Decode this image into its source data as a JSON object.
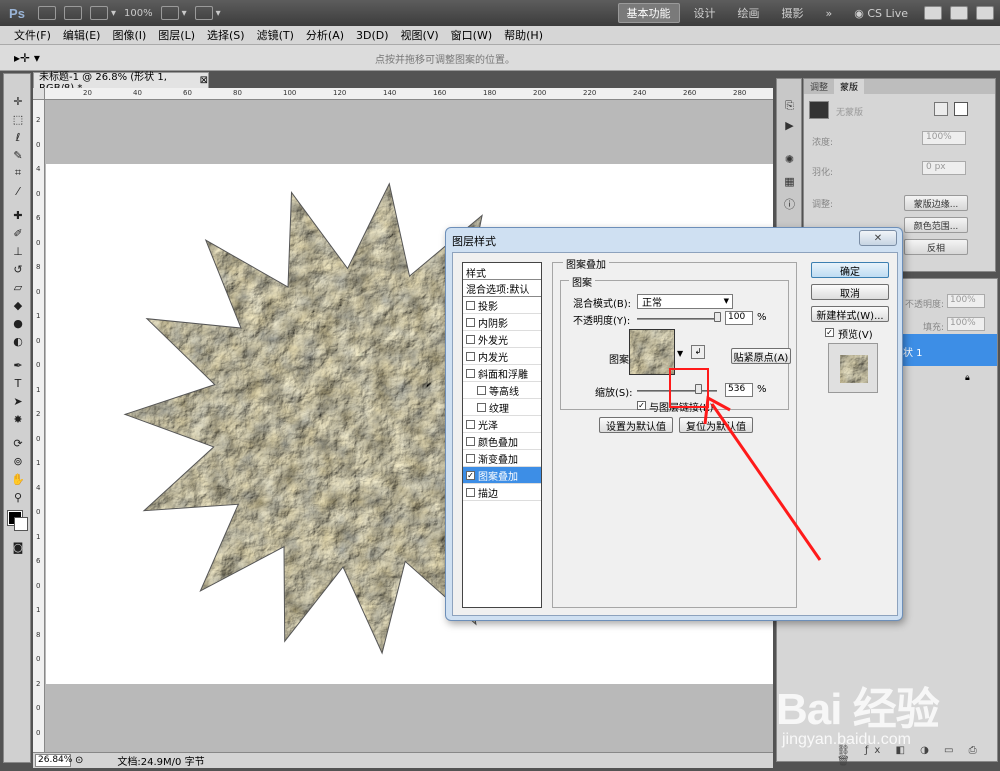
{
  "app": {
    "logo": "Ps",
    "zoom_preset": "100%",
    "workspaces": [
      "基本功能",
      "设计",
      "绘画",
      "摄影"
    ],
    "more": "»",
    "cs_live": "CS Live"
  },
  "menu": [
    "文件(F)",
    "编辑(E)",
    "图像(I)",
    "图层(L)",
    "选择(S)",
    "滤镜(T)",
    "分析(A)",
    "3D(D)",
    "视图(V)",
    "窗口(W)",
    "帮助(H)"
  ],
  "options_hint": "点按并拖移可调整图案的位置。",
  "document": {
    "tab_title": "未标题-1 @ 26.8% (形状 1, RGB/8) *",
    "ruler_h": [
      "20",
      "40",
      "60",
      "80",
      "100",
      "120",
      "140",
      "160",
      "180",
      "200",
      "220",
      "240",
      "260",
      "280"
    ],
    "ruler_v": [
      "2",
      "0",
      "4",
      "0",
      "6",
      "0",
      "8",
      "0",
      "1",
      "0",
      "0",
      "1",
      "2",
      "0",
      "1",
      "4",
      "0",
      "1",
      "6",
      "0",
      "1",
      "8",
      "0",
      "2",
      "0",
      "0"
    ],
    "zoom": "26.84%",
    "doc_info": "文档:24.9M/0 字节"
  },
  "masks_panel": {
    "tabs": [
      "调整",
      "蒙版"
    ],
    "no_mask": "无蒙版",
    "density_label": "浓度:",
    "density_value": "100%",
    "feather_label": "羽化:",
    "feather_value": "0 px",
    "refine_label": "调整:",
    "btn_mask_edge": "蒙版边缘...",
    "btn_color_range": "颜色范围...",
    "btn_invert": "反相"
  },
  "layers_panel": {
    "opacity_label": "不透明度:",
    "opacity_value": "100%",
    "fill_label": "填充:",
    "fill_value": "100%",
    "selected_layer": "状 1"
  },
  "dialog": {
    "title": "图层样式",
    "close": "✕",
    "styles_header": "样式",
    "blend_options": "混合选项:默认",
    "styles": [
      {
        "label": "投影",
        "checked": false,
        "indent": false
      },
      {
        "label": "内阴影",
        "checked": false,
        "indent": false
      },
      {
        "label": "外发光",
        "checked": false,
        "indent": false
      },
      {
        "label": "内发光",
        "checked": false,
        "indent": false
      },
      {
        "label": "斜面和浮雕",
        "checked": false,
        "indent": false
      },
      {
        "label": "等高线",
        "checked": false,
        "indent": true
      },
      {
        "label": "纹理",
        "checked": false,
        "indent": true
      },
      {
        "label": "光泽",
        "checked": false,
        "indent": false
      },
      {
        "label": "颜色叠加",
        "checked": false,
        "indent": false
      },
      {
        "label": "渐变叠加",
        "checked": false,
        "indent": false
      },
      {
        "label": "图案叠加",
        "checked": true,
        "indent": false,
        "selected": true
      },
      {
        "label": "描边",
        "checked": false,
        "indent": false
      }
    ],
    "section_title": "图案叠加",
    "subsection_title": "图案",
    "blend_mode_label": "混合模式(B):",
    "blend_mode_value": "正常",
    "opacity_label": "不透明度(Y):",
    "opacity_value": "100",
    "opacity_fraction": 1.0,
    "percent": "%",
    "pattern_label": "图案:",
    "snap_origin": "贴紧原点(A)",
    "scale_label": "缩放(S):",
    "scale_value": "536",
    "scale_fraction": 0.536,
    "link_label": "与图层链接(K)",
    "link_checked": true,
    "make_default": "设置为默认值",
    "reset_default": "复位为默认值",
    "ok": "确定",
    "cancel": "取消",
    "new_style": "新建样式(W)...",
    "preview_label": "预览(V)",
    "preview_checked": true
  },
  "watermark": {
    "brand": "Bai  经验",
    "url": "jingyan.baidu.com"
  }
}
